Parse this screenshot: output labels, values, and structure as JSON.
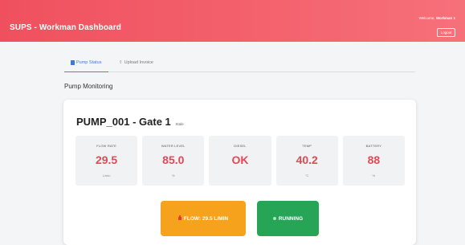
{
  "header": {
    "title": "SUPS - Workman Dashboard",
    "welcome_prefix": "Welcome,",
    "welcome_name": "Workman 1",
    "logout_label": "Logout"
  },
  "tabs": [
    {
      "label": "Pump Status",
      "icon": "document-icon",
      "active": true
    },
    {
      "label": "Upload Invoice",
      "icon": "upload-icon",
      "active": false
    }
  ],
  "section_title": "Pump Monitoring",
  "pump": {
    "name": "PUMP_001 - Gate 1",
    "status": "Stale"
  },
  "metrics": [
    {
      "label": "FLOW RATE",
      "value": "29.5",
      "unit": "L/min"
    },
    {
      "label": "WATER LEVEL",
      "value": "85.0",
      "unit": "%"
    },
    {
      "label": "DIESEL",
      "value": "OK",
      "unit": ""
    },
    {
      "label": "TEMP",
      "value": "40.2",
      "unit": "°C"
    },
    {
      "label": "BATTERY",
      "value": "88",
      "unit": "%"
    }
  ],
  "actions": {
    "flow_label": "FLOW: 29.5 L/MIN",
    "running_label": "RUNNING"
  },
  "colors": {
    "header_start": "#f0505e",
    "header_end": "#f6707a",
    "metric_value": "#e04a55",
    "flow_button": "#f7a21c",
    "running_button": "#27a556",
    "active_tab": "#3a7bd5"
  }
}
